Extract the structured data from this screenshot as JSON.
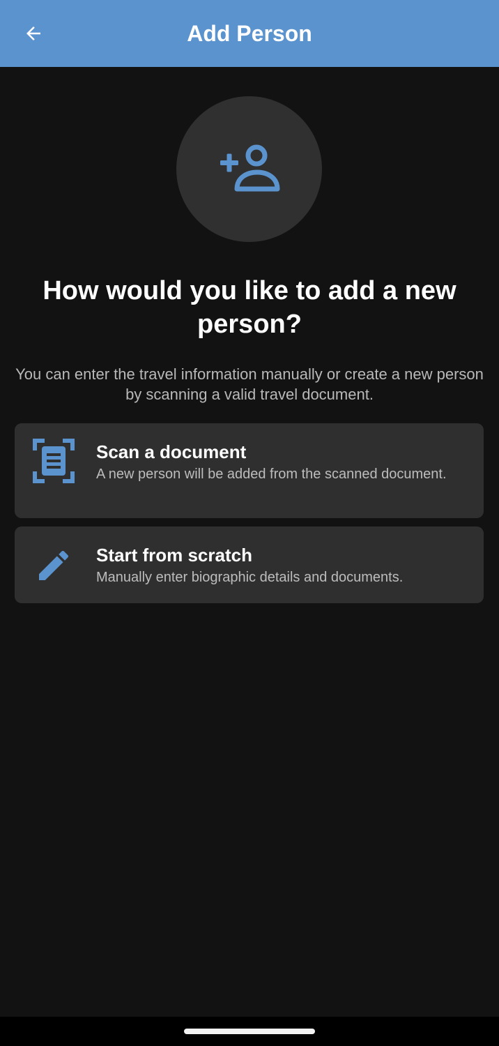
{
  "app_bar": {
    "title": "Add Person",
    "back_icon": "arrow-left-icon",
    "background_color": "#5b93cf"
  },
  "hero": {
    "icon": "person-add-icon",
    "accent_color": "#5b93cf"
  },
  "headline": "How would you like to add a new person?",
  "subtitle": "You can enter the travel information manually or create a new person by scanning a valid travel document.",
  "options": [
    {
      "icon": "document-scan-icon",
      "title": "Scan a document",
      "description": "A new person will be added from the scanned document."
    },
    {
      "icon": "pencil-icon",
      "title": "Start from scratch",
      "description": "Manually enter biographic details and documents."
    }
  ]
}
